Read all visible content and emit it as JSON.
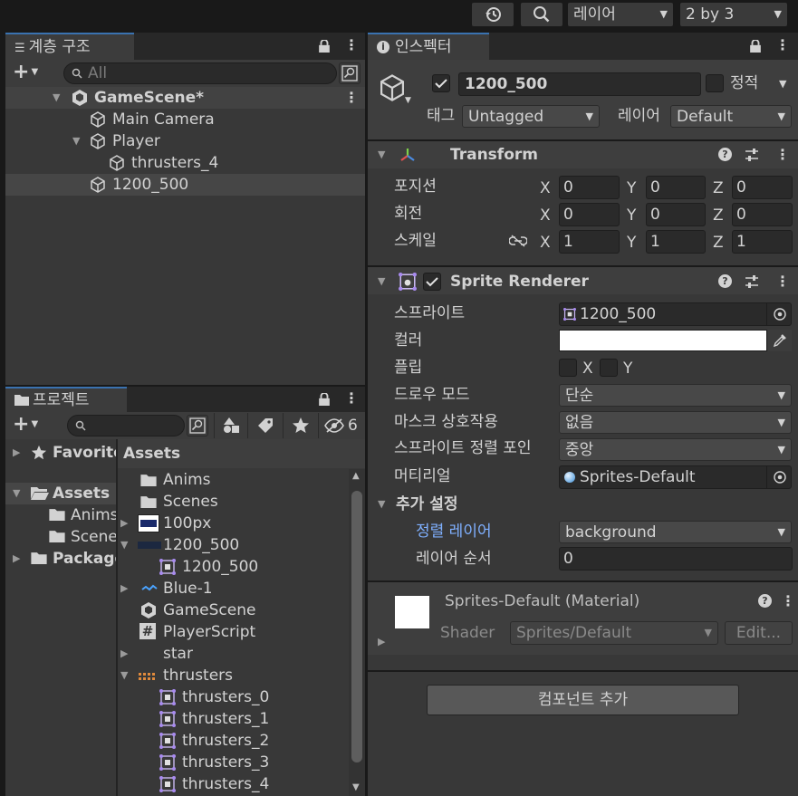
{
  "toolbar": {
    "layers_label": "레이어",
    "layout_label": "2 by 3"
  },
  "hierarchy": {
    "tab_label": "계층 구조",
    "search_placeholder": "All",
    "scene_name": "GameScene*",
    "items": [
      {
        "label": "Main Camera"
      },
      {
        "label": "Player"
      },
      {
        "label": "thrusters_4"
      },
      {
        "label": "1200_500"
      }
    ]
  },
  "project": {
    "tab_label": "프로젝트",
    "hidden_count": "6",
    "sidebar": {
      "favorites": "Favorites",
      "assets": "Assets",
      "anims": "Anims",
      "scenes": "Scenes",
      "packages": "Packages"
    },
    "breadcrumb": "Assets",
    "assets": [
      {
        "label": "Anims"
      },
      {
        "label": "Scenes"
      },
      {
        "label": "100px"
      },
      {
        "label": "1200_500"
      },
      {
        "label": "1200_500"
      },
      {
        "label": "Blue-1"
      },
      {
        "label": "GameScene"
      },
      {
        "label": "PlayerScript"
      },
      {
        "label": "star"
      },
      {
        "label": "thrusters"
      },
      {
        "label": "thrusters_0"
      },
      {
        "label": "thrusters_1"
      },
      {
        "label": "thrusters_2"
      },
      {
        "label": "thrusters_3"
      },
      {
        "label": "thrusters_4"
      }
    ]
  },
  "inspector": {
    "tab_label": "인스펙터",
    "object_name": "1200_500",
    "static_label": "정적",
    "tag_label": "태그",
    "tag_value": "Untagged",
    "layer_label": "레이어",
    "layer_value": "Default",
    "transform": {
      "title": "Transform",
      "position_label": "포지션",
      "rotation_label": "회전",
      "scale_label": "스케일",
      "x": "X",
      "y": "Y",
      "z": "Z",
      "position": [
        "0",
        "0",
        "0"
      ],
      "rotation": [
        "0",
        "0",
        "0"
      ],
      "scale": [
        "1",
        "1",
        "1"
      ]
    },
    "sprite_renderer": {
      "title": "Sprite Renderer",
      "sprite_label": "스프라이트",
      "sprite_value": "1200_500",
      "color_label": "컬러",
      "color_value": "#ffffff",
      "flip_label": "플립",
      "flip_x": "X",
      "flip_y": "Y",
      "draw_mode_label": "드로우 모드",
      "draw_mode_value": "단순",
      "mask_label": "마스크 상호작용",
      "mask_value": "없음",
      "sort_point_label": "스프라이트 정렬 포인",
      "sort_point_value": "중앙",
      "material_label": "머티리얼",
      "material_value": "Sprites-Default",
      "additional_label": "추가 설정",
      "sorting_layer_label": "정렬 레이어",
      "sorting_layer_value": "background",
      "order_label": "레이어 순서",
      "order_value": "0"
    },
    "material": {
      "title": "Sprites-Default (Material)",
      "shader_label": "Shader",
      "shader_value": "Sprites/Default",
      "edit_label": "Edit..."
    },
    "add_component_label": "컴포넌트 추가"
  },
  "colors": {
    "accent": "#3a72b0",
    "link": "#7fb0ff",
    "panel": "#383838",
    "selection": "#464646"
  }
}
